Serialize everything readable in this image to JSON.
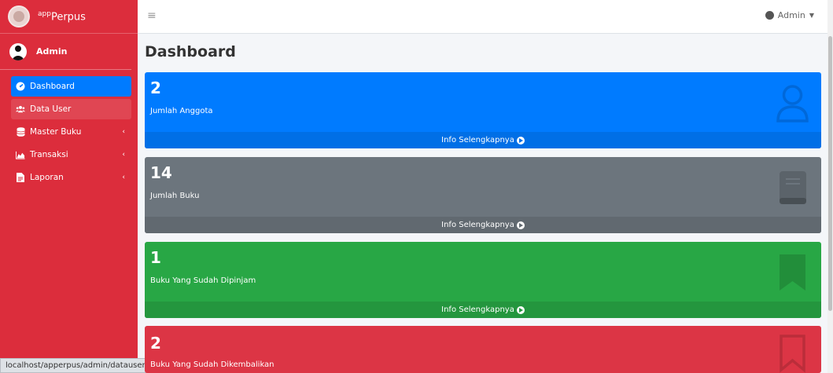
{
  "brand": {
    "name_sup": "app",
    "name": "Perpus"
  },
  "user_panel": {
    "name": "Admin"
  },
  "sidebar": {
    "items": [
      {
        "label": "Dashboard",
        "icon": "dashboard-icon",
        "active": true
      },
      {
        "label": "Data User",
        "icon": "users-icon"
      },
      {
        "label": "Master Buku",
        "icon": "database-icon",
        "caret": "‹"
      },
      {
        "label": "Transaksi",
        "icon": "chart-area-icon",
        "caret": "‹"
      },
      {
        "label": "Laporan",
        "icon": "file-icon",
        "caret": "‹"
      }
    ]
  },
  "topbar": {
    "menu_icon": "≡",
    "user_label": "Admin"
  },
  "page": {
    "title": "Dashboard"
  },
  "boxes": [
    {
      "value": "2",
      "label": "Jumlah Anggota",
      "footer": "Info Selengkapnya",
      "color": "#007bff",
      "icon": "user-icon"
    },
    {
      "value": "14",
      "label": "Jumlah Buku",
      "footer": "Info Selengkapnya",
      "color": "#6c757d",
      "icon": "book-icon"
    },
    {
      "value": "1",
      "label": "Buku Yang Sudah Dipinjam",
      "footer": "Info Selengkapnya",
      "color": "#28a745",
      "icon": "bookmark-icon"
    },
    {
      "value": "2",
      "label": "Buku Yang Sudah Dikembalikan",
      "color": "#dc3545",
      "icon": "bookmark-outline-icon"
    }
  ],
  "status_bar": {
    "url": "localhost/apperpus/admin/datauser"
  }
}
